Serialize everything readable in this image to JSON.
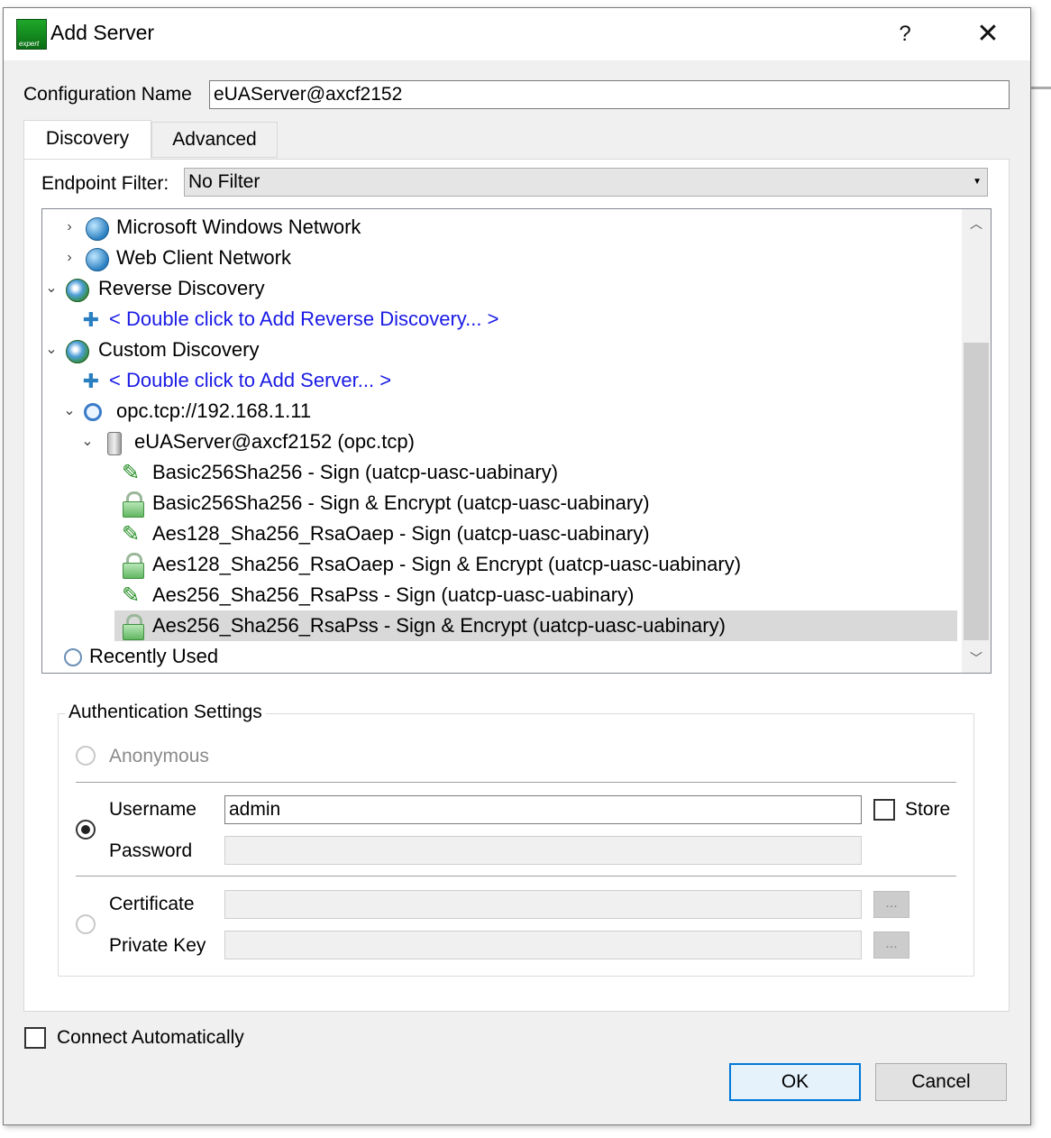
{
  "window": {
    "title": "Add Server",
    "app_icon_label": "expert",
    "help_glyph": "?",
    "close_glyph": "✕"
  },
  "config": {
    "label": "Configuration Name",
    "value": "eUAServer@axcf2152"
  },
  "tabs": [
    {
      "label": "Discovery",
      "active": true
    },
    {
      "label": "Advanced",
      "active": false
    }
  ],
  "filter": {
    "label": "Endpoint Filter:",
    "value": "No Filter"
  },
  "tree": {
    "items": [
      {
        "text": "Microsoft Windows Network",
        "expander": "›",
        "icon": "network-globe-icon"
      },
      {
        "text": "Web Client Network",
        "expander": "›",
        "icon": "network-globe-icon"
      },
      {
        "text": "Reverse Discovery",
        "expander": "⌄",
        "icon": "discovery-globe-icon"
      },
      {
        "text": "< Double click to Add Reverse Discovery... >",
        "icon": "add-icon"
      },
      {
        "text": "Custom Discovery",
        "expander": "⌄",
        "icon": "discovery-globe-icon"
      },
      {
        "text": "< Double click to Add Server... >",
        "icon": "add-icon"
      },
      {
        "text": "opc.tcp://192.168.1.11",
        "expander": "⌄",
        "icon": "magnifier-icon"
      },
      {
        "text": "eUAServer@axcf2152 (opc.tcp)",
        "expander": "⌄",
        "icon": "server-icon"
      },
      {
        "text": "Basic256Sha256 - Sign (uatcp-uasc-uabinary)",
        "icon": "pen-icon"
      },
      {
        "text": "Basic256Sha256 - Sign & Encrypt (uatcp-uasc-uabinary)",
        "icon": "lock-icon"
      },
      {
        "text": "Aes128_Sha256_RsaOaep - Sign (uatcp-uasc-uabinary)",
        "icon": "pen-icon"
      },
      {
        "text": "Aes128_Sha256_RsaOaep - Sign & Encrypt (uatcp-uasc-uabinary)",
        "icon": "lock-icon"
      },
      {
        "text": "Aes256_Sha256_RsaPss - Sign (uatcp-uasc-uabinary)",
        "icon": "pen-icon"
      },
      {
        "text": "Aes256_Sha256_RsaPss - Sign & Encrypt (uatcp-uasc-uabinary)",
        "icon": "lock-icon",
        "selected": true
      },
      {
        "text": "Recently Used",
        "icon": "clock-icon"
      }
    ]
  },
  "auth": {
    "title": "Authentication Settings",
    "anonymous_label": "Anonymous",
    "username_label": "Username",
    "username_value": "admin",
    "password_label": "Password",
    "store_label": "Store",
    "certificate_label": "Certificate",
    "private_key_label": "Private Key",
    "browse_label": "...",
    "selected_mode": "username"
  },
  "connect_auto_label": "Connect Automatically",
  "buttons": {
    "ok": "OK",
    "cancel": "Cancel"
  },
  "colors": {
    "link_blue": "#1a1ae6",
    "default_button_border": "#0078d7",
    "selection_bg": "#d9d9d9"
  }
}
